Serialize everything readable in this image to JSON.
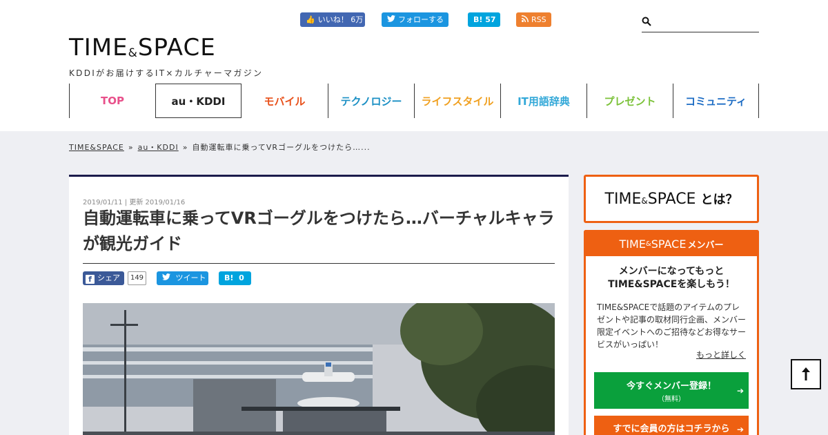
{
  "header": {
    "social": {
      "fb_like_label": "いいね！",
      "fb_like_count": "6万",
      "twitter_follow_label": "フォローする",
      "hatena_label": "B!",
      "hatena_count": "57",
      "rss_label": "RSS"
    },
    "search": {
      "placeholder": ""
    },
    "logo": {
      "main_a": "TIME",
      "amp": "&",
      "main_b": "SPACE",
      "tagline": "KDDIがお届けするIT×カルチャーマガジン"
    },
    "nav": [
      {
        "label": "TOP",
        "color": "#e8508a"
      },
      {
        "label": "au・KDDI",
        "color": "#222222"
      },
      {
        "label": "モバイル",
        "color": "#e8501a"
      },
      {
        "label": "テクノロジー",
        "color": "#1a8fc4"
      },
      {
        "label": "ライフスタイル",
        "color": "#f0a020"
      },
      {
        "label": "IT用語辞典",
        "color": "#32a8d8"
      },
      {
        "label": "プレゼント",
        "color": "#7cc23a"
      },
      {
        "label": "コミュニティ",
        "color": "#1c6cc4"
      }
    ]
  },
  "breadcrumb": {
    "home": "TIME&SPACE",
    "sep1": "»",
    "category": "au・KDDI",
    "sep2": "»",
    "current": "自動運転車に乗ってVRゴーグルをつけたら…..."
  },
  "article": {
    "dates": "2019/01/11 | 更新 2019/01/16",
    "title": "自動運転車に乗ってVRゴーグルをつけたら…バーチャルキャラが観光ガイド",
    "share": {
      "fb_label": "シェア",
      "fb_count": "149",
      "tw_label": "ツイート",
      "hb_label": "B!",
      "hb_count": "0"
    }
  },
  "sidebar": {
    "about": {
      "main_a": "TIME",
      "amp": "&",
      "main_b": "SPACE",
      "suffix": "とは？"
    },
    "member": {
      "header_a": "TIME",
      "header_amp": "&",
      "header_b": "SPACE",
      "header_suffix": "メンバー",
      "lead_line1": "メンバーになってもっと",
      "lead_line2": "TIME&SPACEを楽しもう！",
      "description": "TIME&SPACEで話題のアイテムのプレゼントや記事の取材同行企画、メンバー限定イベントへのご招待などお得なサービスがいっぱい！",
      "more_link": "もっと詳しく",
      "register_main": "今すぐメンバー登録！",
      "register_sub": "（無料）",
      "login_label": "すでに会員の方はコチラから",
      "arrow": "➔"
    }
  },
  "pagetop": {
    "arrow": "⭡"
  },
  "colors": {
    "accent_orange": "#ee6012",
    "register_green": "#0aa03c",
    "article_rule": "#1b1b4b",
    "content_bg": "#eeeff3"
  }
}
